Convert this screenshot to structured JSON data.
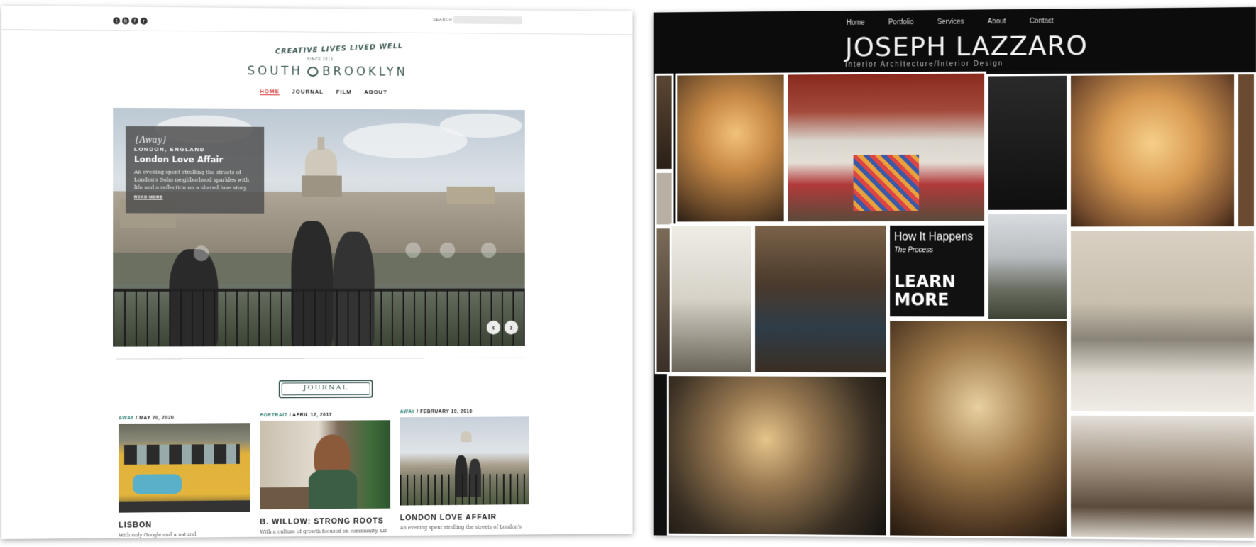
{
  "left_site": {
    "social_icons": [
      "t",
      "b",
      "f",
      "r"
    ],
    "search": {
      "label": "SEARCH",
      "placeholder": ""
    },
    "header": {
      "tagline": "CREATIVE LIVES LIVED WELL",
      "since": "SINCE 2016",
      "logo_left": "SOUTH",
      "logo_right": "BROOKLYN"
    },
    "nav": [
      "HOME",
      "JOURNAL",
      "FILM",
      "ABOUT"
    ],
    "hero": {
      "category": "{Away}",
      "location": "LONDON, ENGLAND",
      "title": "London Love Affair",
      "description": "An evening spent strolling the streets of London's Soho neighborhood sparkles with life and a reflection on a shared love story.",
      "read_more": "READ MORE",
      "prev": "‹",
      "next": "›"
    },
    "section_title": "JOURNAL",
    "posts": [
      {
        "category": "AWAY",
        "date": "/ MAY 20, 2020",
        "title": "LISBON",
        "excerpt": "With only Google and a natural"
      },
      {
        "category": "PORTRAIT",
        "date": "/ APRIL 12, 2017",
        "title": "B. WILLOW: STRONG ROOTS",
        "excerpt": "With a culture of growth focused on community, Lit"
      },
      {
        "category": "AWAY",
        "date": "/ FEBRUARY 19, 2016",
        "title": "LONDON LOVE AFFAIR",
        "excerpt": "An evening spent strolling the streets of London's"
      }
    ]
  },
  "right_site": {
    "nav": [
      "Home",
      "Portfolio",
      "Services",
      "About",
      "Contact"
    ],
    "title": "JOSEPH LAZZARO",
    "subtitle": "Interior Architecture/Interior Design",
    "promo": {
      "heading": "How It Happens",
      "subheading": "The Process",
      "cta": "LEARN MORE"
    }
  },
  "colors": {
    "brand_green": "#3d5a55",
    "nav_active": "#d63a3a",
    "category_teal": "#2e7d74",
    "right_bg": "#101010"
  }
}
